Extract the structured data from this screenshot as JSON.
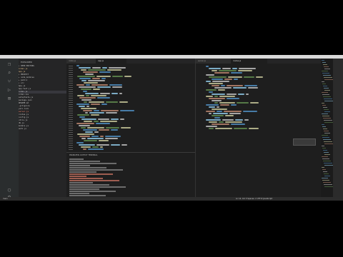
{
  "window": {
    "menu_items": [
      "",
      "",
      "",
      "",
      "",
      "",
      "",
      "",
      "",
      ""
    ]
  },
  "sidebar": {
    "title": "EXPLORER",
    "items": [
      {
        "label": "▾ OPEN EDITORS",
        "state": "normal"
      },
      {
        "label": "  index.js",
        "state": "mod"
      },
      {
        "label": "  App.js",
        "state": "mod"
      },
      {
        "label": "▾ PROJECT",
        "state": "normal"
      },
      {
        "label": "  ▸ node_modules",
        "state": "normal"
      },
      {
        "label": "  ▸ public",
        "state": "normal"
      },
      {
        "label": "  ▾ src",
        "state": "normal"
      },
      {
        "label": "    App.js",
        "state": "normal"
      },
      {
        "label": "    App.test.js",
        "state": "normal"
      },
      {
        "label": "    index.js",
        "state": "sel"
      },
      {
        "label": "    index.css",
        "state": "normal"
      },
      {
        "label": "    setupTests.js",
        "state": "normal"
      },
      {
        "label": "  package.json",
        "state": "normal"
      },
      {
        "label": "  README.md",
        "state": "normal"
      },
      {
        "label": "  .gitignore",
        "state": "normal"
      },
      {
        "label": "  yarn.lock",
        "state": "normal"
      },
      {
        "label": "  server.js",
        "state": "err"
      },
      {
        "label": "  routes.js",
        "state": "normal"
      },
      {
        "label": "  config.js",
        "state": "normal"
      },
      {
        "label": "  utils.js",
        "state": "normal"
      },
      {
        "label": "  db.js",
        "state": "normal"
      },
      {
        "label": "  models.js",
        "state": "normal"
      },
      {
        "label": "  auth.js",
        "state": "normal"
      }
    ]
  },
  "editor_left": {
    "tabs": [
      {
        "label": "index.js",
        "active": false
      },
      {
        "label": "App.js",
        "active": true
      }
    ]
  },
  "editor_right": {
    "tabs": [
      {
        "label": "server.js",
        "active": false
      },
      {
        "label": "routes.js",
        "active": true
      }
    ]
  },
  "panel": {
    "tabs_label": "PROBLEMS   OUTPUT   TERMINAL"
  },
  "statusbar": {
    "left": "main",
    "right": "Ln 14, Col 3   Spaces: 2   UTF-8   JavaScript"
  },
  "colors": {
    "keyword": "#569cd6",
    "string": "#ce9178",
    "function": "#dcdcaa",
    "variable": "#9cdcfe",
    "comment": "#6a9955",
    "plain": "#d4d4d4",
    "error": "#f48771"
  }
}
